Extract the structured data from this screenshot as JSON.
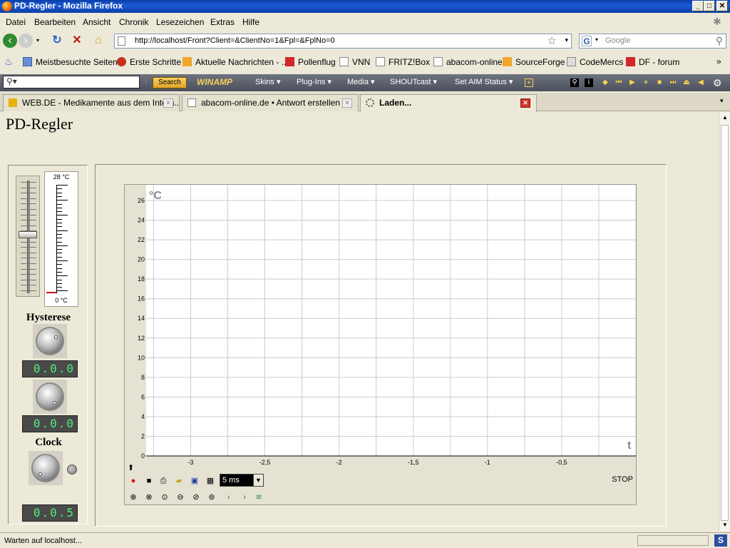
{
  "window": {
    "title": "PD-Regler - Mozilla Firefox",
    "min": "_",
    "max": "□",
    "close": "✕"
  },
  "menu": [
    "Datei",
    "Bearbeiten",
    "Ansicht",
    "Chronik",
    "Lesezeichen",
    "Extras",
    "Hilfe"
  ],
  "nav": {
    "url": "http://localhost/Front?Client=&ClientNo=1&Fpl=&FplNo=0",
    "search_placeholder": "Google"
  },
  "bookmarks": [
    "Meistbesuchte Seiten",
    "Erste Schritte",
    "Aktuelle Nachrichten - ...",
    "Pollenflug",
    "VNN",
    "FRITZ!Box",
    "abacom-online",
    "SourceForge",
    "CodeMercs",
    "DF - forum"
  ],
  "winamp": {
    "search_label": "Search",
    "logo": "WINAMP",
    "menus": [
      "Skins",
      "Plug-Ins",
      "Media",
      "SHOUTcast",
      "Set AIM Status"
    ]
  },
  "tabs": [
    {
      "label": "WEB.DE - Medikamente aus dem Intern...",
      "active": false
    },
    {
      "label": "abacom-online.de • Antwort erstellen",
      "active": false
    },
    {
      "label": "Laden...",
      "active": true
    }
  ],
  "page": {
    "title": "PD-Regler",
    "slider_value": 0.52,
    "thermo": {
      "top": "28 °C",
      "bottom": "0 °C"
    },
    "hysterese_label": "Hysterese",
    "clock_label": "Clock",
    "lcd1": "0.0.0",
    "lcd2": "0.0.0",
    "lcd3": "0.0.5",
    "ms_value": "5 ms",
    "stop": "STOP"
  },
  "chart_data": {
    "type": "line",
    "series": [],
    "ylabel": "°C",
    "xlabel": "t",
    "ylim": [
      0,
      26
    ],
    "xlim": [
      -3.3,
      0
    ],
    "yticks": [
      0,
      2,
      4,
      6,
      8,
      10,
      12,
      14,
      16,
      18,
      20,
      22,
      24,
      26
    ],
    "xticks": [
      -3,
      -2.5,
      -2,
      -1.5,
      -1,
      -0.5
    ],
    "grid": true
  },
  "status": {
    "text": "Warten auf localhost..."
  }
}
